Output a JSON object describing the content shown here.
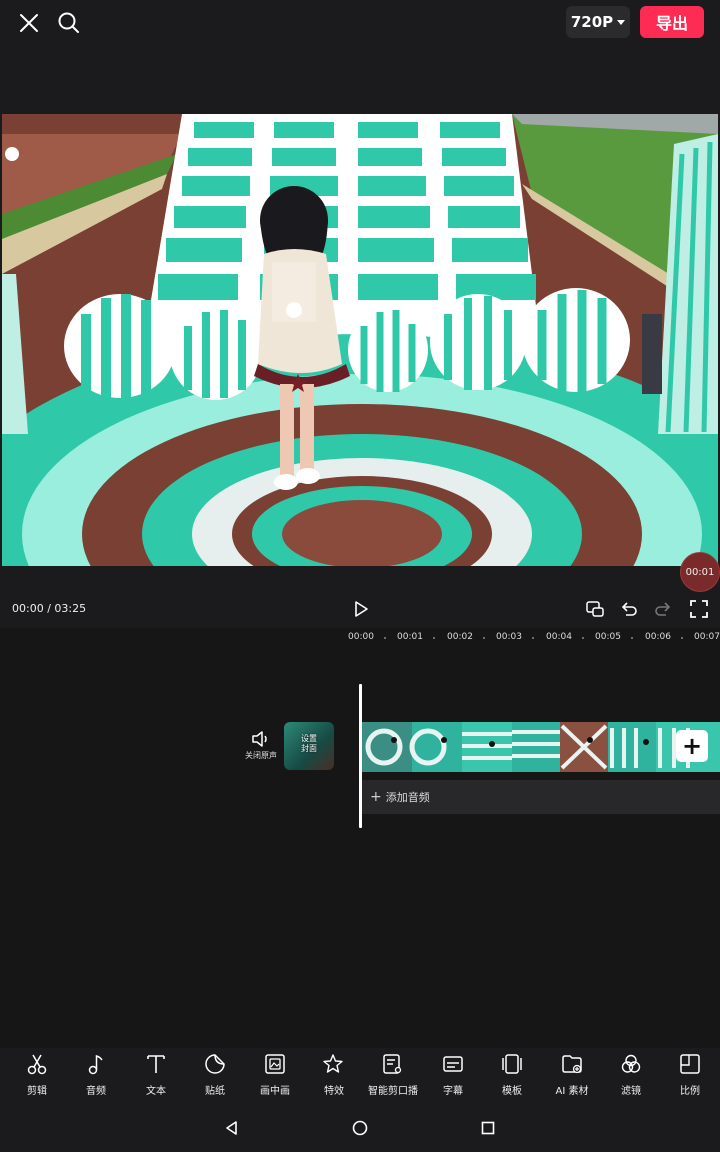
{
  "topbar": {
    "resolution": "720P",
    "export_label": "导出"
  },
  "preview": {
    "time_badge": "00:01"
  },
  "controls": {
    "timecode": "00:00 / 03:25"
  },
  "ruler": {
    "ticks": [
      "00:00",
      "00:01",
      "00:02",
      "00:03",
      "00:04",
      "00:05",
      "00:06",
      "00:07"
    ]
  },
  "track": {
    "mute_label": "关闭原声",
    "cover_label_line1": "设置",
    "cover_label_line2": "封面",
    "add_audio_label": "添加音频"
  },
  "toolbar": {
    "items": [
      {
        "label": "剪辑",
        "icon": "scissors-icon"
      },
      {
        "label": "音频",
        "icon": "music-note-icon"
      },
      {
        "label": "文本",
        "icon": "text-icon"
      },
      {
        "label": "贴纸",
        "icon": "sticker-icon"
      },
      {
        "label": "画中画",
        "icon": "picture-in-picture-icon"
      },
      {
        "label": "特效",
        "icon": "effects-star-icon"
      },
      {
        "label": "智能剪口播",
        "icon": "smart-cut-icon"
      },
      {
        "label": "字幕",
        "icon": "subtitle-icon"
      },
      {
        "label": "模板",
        "icon": "template-icon"
      },
      {
        "label": "AI 素材",
        "icon": "ai-material-icon"
      },
      {
        "label": "滤镜",
        "icon": "filter-icon"
      },
      {
        "label": "比例",
        "icon": "ratio-icon"
      }
    ]
  },
  "colors": {
    "accent": "#fe2c55",
    "background": "#1b1b1d",
    "teal": "#2fc9a9"
  }
}
